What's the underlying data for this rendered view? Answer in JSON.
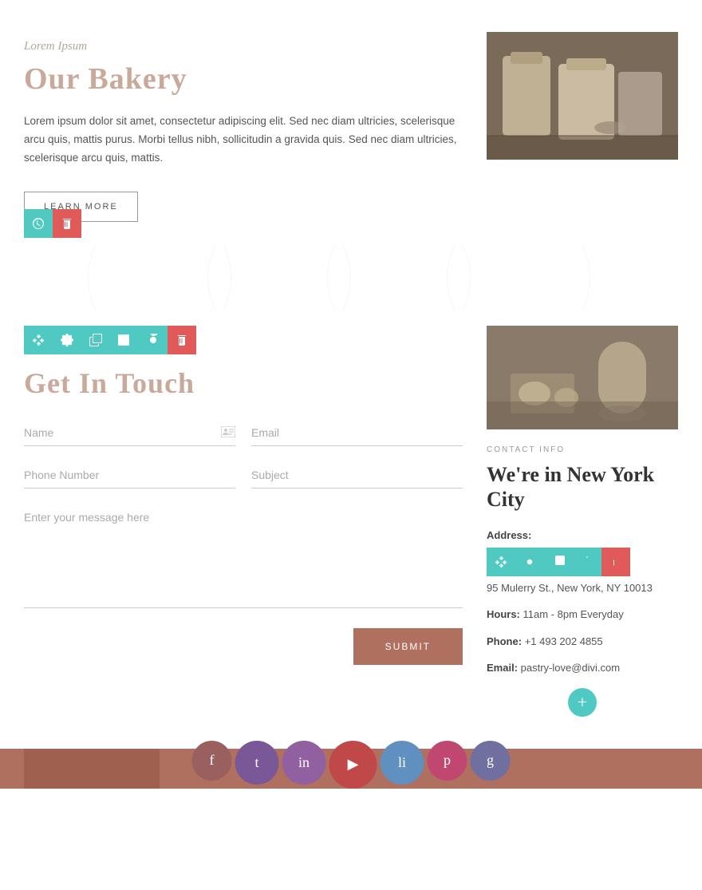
{
  "top": {
    "subtitle": "Lorem Ipsum",
    "title": "Our Bakery",
    "description": "Lorem ipsum dolor sit amet, consectetur adipiscing elit. Sed nec diam ultricies, scelerisque arcu quis, mattis purus. Morbi tellus nibh, sollicitudin a gravida quis. Sed nec diam ultricies, scelerisque arcu quis, mattis.",
    "learn_more_label": "LEARN MORE"
  },
  "contact_section": {
    "title": "Get In Touch",
    "form": {
      "name_placeholder": "Name",
      "email_placeholder": "Email",
      "phone_placeholder": "Phone Number",
      "subject_placeholder": "Subject",
      "message_placeholder": "Enter your message here",
      "submit_label": "SUBMIT"
    },
    "info": {
      "label": "CONTACT INFO",
      "city_title": "We're in New York City",
      "address_label": "Address:",
      "address_value": "95 Mulerry St., New York, NY 10013",
      "hours_label": "Hours:",
      "hours_value": "11am - 8pm Everyday",
      "phone_label": "Phone:",
      "phone_value": "+1 493 202 4855",
      "email_label": "Email:",
      "email_value": "pastry-love@divi.com"
    }
  },
  "toolbar": {
    "move_label": "move",
    "settings_label": "settings",
    "duplicate_label": "duplicate",
    "columns_label": "columns",
    "toggle_label": "toggle",
    "delete_label": "delete"
  },
  "footer": {
    "icons": [
      "fb",
      "tw",
      "ig",
      "yt",
      "li",
      "pi"
    ]
  },
  "colors": {
    "accent_pink": "#c9a99a",
    "accent_teal": "#4fc9c2",
    "accent_brown": "#b07060",
    "accent_red": "#e05a5a"
  }
}
